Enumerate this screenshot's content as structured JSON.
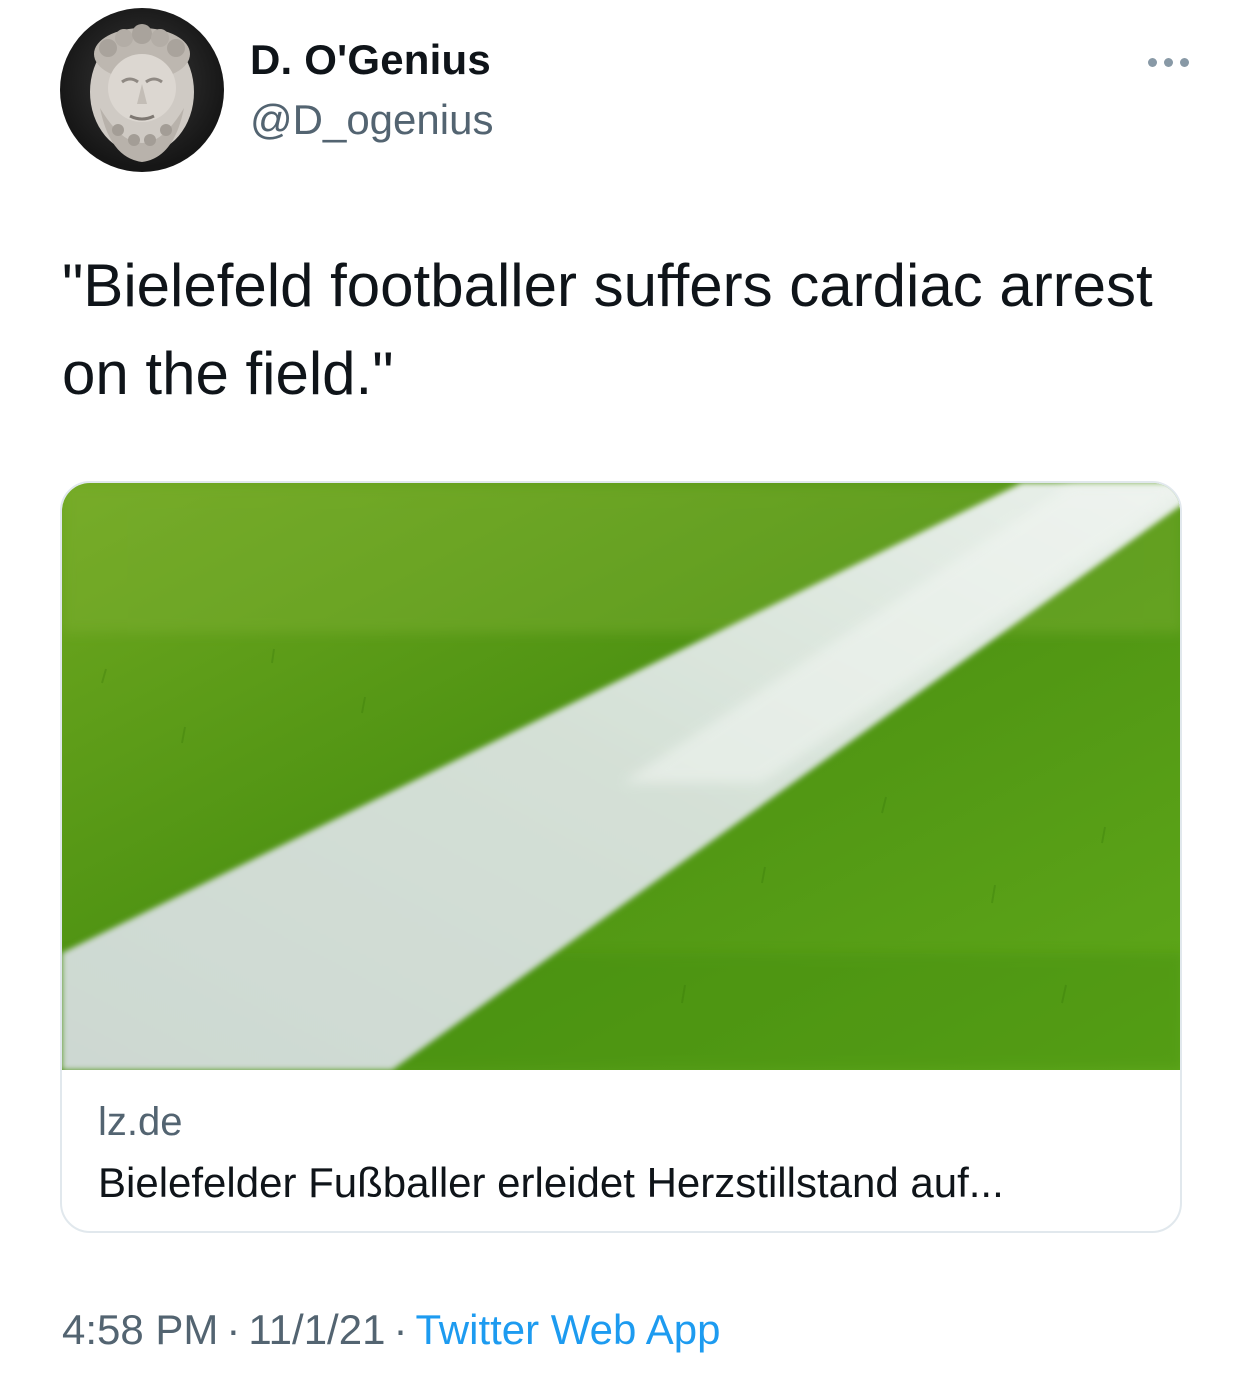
{
  "author": {
    "display_name": "D. O'Genius",
    "handle": "@D_ogenius",
    "avatar_icon": "marble-bust-avatar"
  },
  "more_icon": "more-dots-icon",
  "tweet": {
    "text": "\"Bielefeld footballer suffers cardiac arrest on the field.\""
  },
  "card": {
    "image_icon": "grass-field-line-photo",
    "domain": "lz.de",
    "title": "Bielefelder Fußballer erleidet Herzstillstand auf..."
  },
  "meta": {
    "time": "4:58 PM",
    "date": "11/1/21",
    "separator": "·",
    "source": "Twitter Web App"
  },
  "colors": {
    "text_primary": "#0f1419",
    "text_secondary": "#536471",
    "link": "#1d9bf0",
    "border": "#e1e8ed",
    "grass": "#4f9a12",
    "field_line": "#dfe9e1"
  }
}
